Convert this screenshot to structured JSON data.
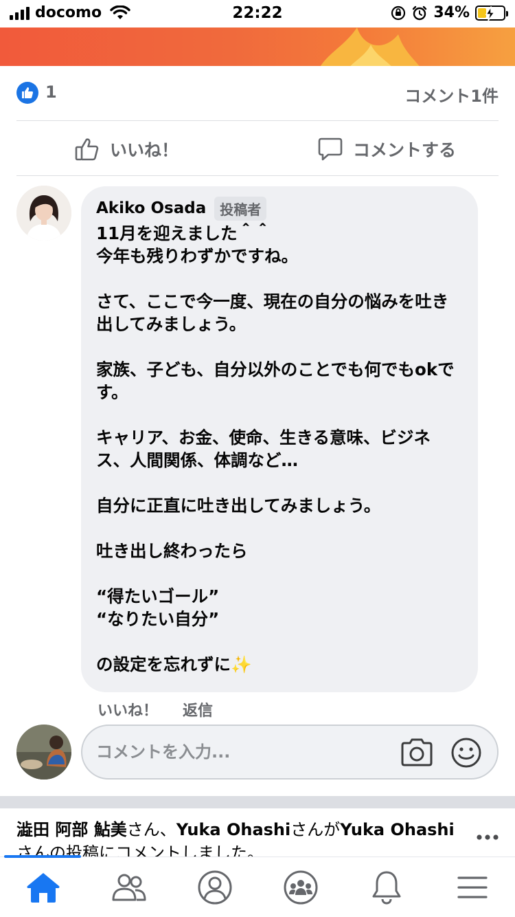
{
  "status_bar": {
    "carrier": "docomo",
    "time": "22:22",
    "battery": "34%",
    "battery_level": 0.34
  },
  "reactions": {
    "like_count": "1",
    "comment_count": "コメント1件"
  },
  "actions": {
    "like_label": "いいね！",
    "comment_label": "コメントする"
  },
  "comment": {
    "author": "Akiko Osada",
    "author_badge": "投稿者",
    "paragraphs": [
      "11月を迎えました＾＾\n今年も残りわずかですね。",
      "さて、ここで今一度、現在の自分の悩みを吐き出してみましょう。",
      "家族、子ども、自分以外のことでも何でもokです。",
      "キャリア、お金、使命、生きる意味、ビジネス、人間関係、体調など…",
      "自分に正直に吐き出してみましょう。",
      "吐き出し終わったら",
      "“得たいゴール”\n“なりたい自分”",
      "の設定を忘れずに✨"
    ],
    "like_action": "いいね！",
    "reply_action": "返信"
  },
  "composer": {
    "placeholder": "コメントを入力..."
  },
  "notification": {
    "name1": "澁田 阿部 鮎美",
    "san1": "さん、",
    "name2": "Yuka Ohashi",
    "san2": "さんが",
    "name3": "Yuka Ohashi",
    "tail": "さんの投稿にコメントしました。"
  },
  "tabbar": {
    "tabs": [
      "home-icon",
      "friends-icon",
      "profile-icon",
      "groups-icon",
      "notifications-icon",
      "menu-icon"
    ],
    "active": 0
  },
  "colors": {
    "accent": "#1877f2",
    "banner": "#f15a3b",
    "bubble": "#eff0f3",
    "muted": "#65676b"
  }
}
